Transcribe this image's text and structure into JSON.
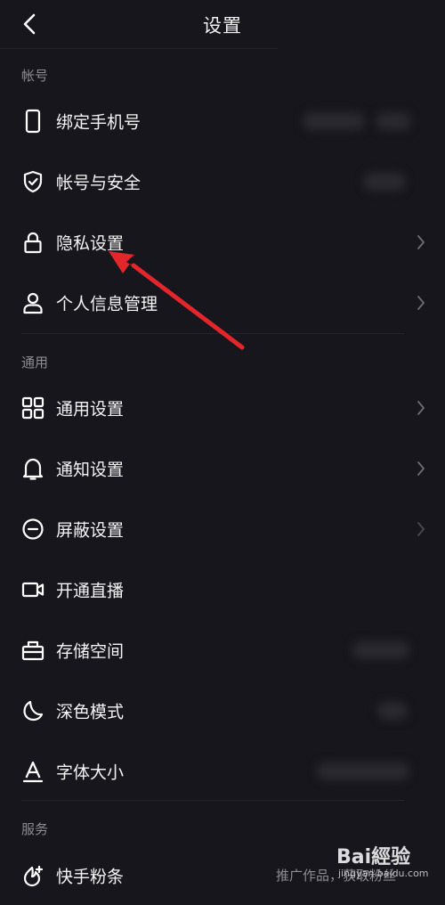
{
  "header": {
    "title": "设置"
  },
  "sections": {
    "account": {
      "title": "帐号",
      "items": [
        {
          "label": "绑定手机号",
          "icon": "phone-icon"
        },
        {
          "label": "帐号与安全",
          "icon": "shield-icon"
        },
        {
          "label": "隐私设置",
          "icon": "lock-icon"
        },
        {
          "label": "个人信息管理",
          "icon": "person-icon"
        }
      ]
    },
    "general": {
      "title": "通用",
      "items": [
        {
          "label": "通用设置",
          "icon": "grid-icon"
        },
        {
          "label": "通知设置",
          "icon": "bell-icon"
        },
        {
          "label": "屏蔽设置",
          "icon": "block-icon"
        },
        {
          "label": "开通直播",
          "icon": "video-icon"
        },
        {
          "label": "存储空间",
          "icon": "storage-icon"
        },
        {
          "label": "深色模式",
          "icon": "moon-icon"
        },
        {
          "label": "字体大小",
          "icon": "font-icon"
        }
      ]
    },
    "service": {
      "title": "服务",
      "items": [
        {
          "label": "快手粉条",
          "icon": "fan-boost-icon",
          "subtext": "推广作品，获取粉丝"
        }
      ]
    }
  },
  "watermark": {
    "main": "Bai經验",
    "sub": "jingyan.baidu.com"
  },
  "colors": {
    "background": "#17161c",
    "text": "#f4f4f4",
    "section": "#8d8c94",
    "arrow": "#e3262c"
  }
}
